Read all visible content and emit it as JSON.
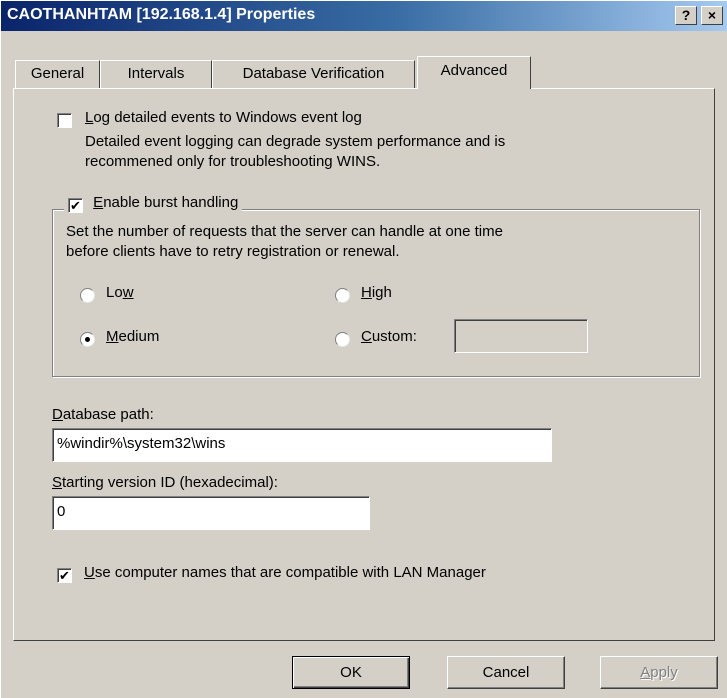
{
  "window": {
    "title": "CAOTHANHTAM [192.168.1.4] Properties",
    "help_button": "?",
    "close_button": "×"
  },
  "tabs": [
    {
      "label": "General",
      "active": false
    },
    {
      "label": "Intervals",
      "active": false
    },
    {
      "label": "Database Verification",
      "active": false
    },
    {
      "label": "Advanced",
      "active": true
    }
  ],
  "log_events": {
    "checked": false,
    "label_key": "L",
    "label_rest": "og detailed events to Windows event log",
    "description_line1": "Detailed event logging can degrade system performance and is",
    "description_line2": "recommened only for troubleshooting WINS."
  },
  "burst": {
    "checked": true,
    "label_key": "E",
    "label_rest": "nable burst handling",
    "description_line1": "Set the number of requests that the server can handle at one time",
    "description_line2": "before clients have to retry registration or renewal.",
    "options": {
      "low": {
        "pre": "Lo",
        "key": "w",
        "post": "",
        "selected": false
      },
      "high": {
        "pre": "",
        "key": "H",
        "post": "igh",
        "selected": false
      },
      "medium": {
        "pre": "",
        "key": "M",
        "post": "edium",
        "selected": true
      },
      "custom": {
        "pre": "",
        "key": "C",
        "post": "ustom:",
        "selected": false
      }
    },
    "custom_value": ""
  },
  "database_path": {
    "label_key": "D",
    "label_rest": "atabase path:",
    "value": "%windir%\\system32\\wins"
  },
  "starting_version": {
    "label_key": "S",
    "label_rest": "tarting version ID (hexadecimal):",
    "value": "0"
  },
  "lan_manager": {
    "checked": true,
    "label_key": "U",
    "label_rest": "se computer names that are compatible with LAN Manager"
  },
  "buttons": {
    "ok": "OK",
    "cancel": "Cancel",
    "apply_key": "A",
    "apply_rest": "pply"
  },
  "check_glyph": "✔"
}
